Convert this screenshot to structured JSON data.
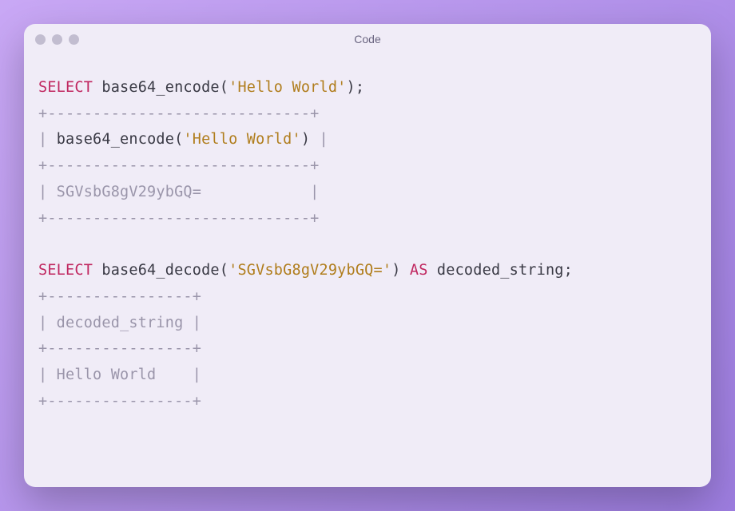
{
  "titlebar": {
    "title": "Code"
  },
  "code": {
    "line1": {
      "kw": "SELECT",
      "fn": " base64_encode(",
      "str": "'Hello World'",
      "tail": ");"
    },
    "border1": "+-----------------------------+",
    "line2": {
      "pipe1": "| ",
      "fn": "base64_encode(",
      "str": "'Hello World'",
      "close": ")",
      "pipe2": " |"
    },
    "border2": "+-----------------------------+",
    "line3": "| SGVsbG8gV29ybGQ=            |",
    "border3": "+-----------------------------+",
    "blank": "",
    "line4": {
      "kw": "SELECT",
      "fn": " base64_decode(",
      "str": "'SGVsbG8gV29ybGQ='",
      "close": ") ",
      "kw2": "AS",
      "alias": " decoded_string;"
    },
    "border4": "+----------------+",
    "line5": "| decoded_string |",
    "border5": "+----------------+",
    "line6": "| Hello World    |",
    "border6": "+----------------+"
  }
}
